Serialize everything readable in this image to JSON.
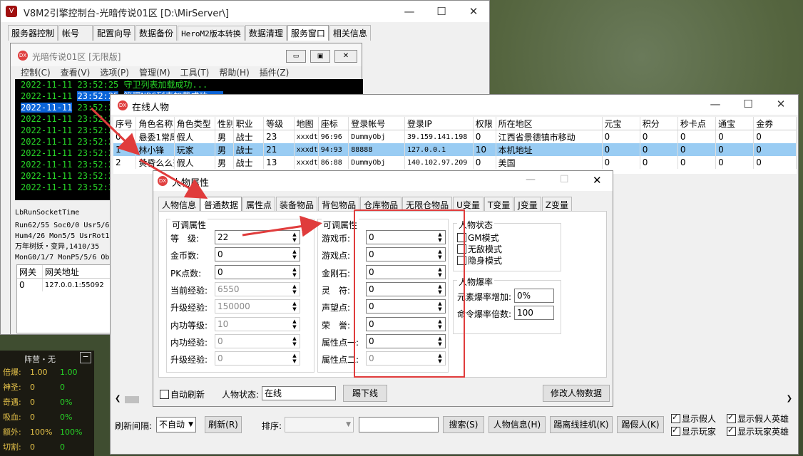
{
  "console_main": {
    "title": "V8M2引擎控制台-光暗传说01区 [D:\\MirServer\\]",
    "tabs": [
      "服务器控制",
      "帐号",
      "配置向导",
      "数据备份",
      "HeroM2版本转换",
      "数据清理",
      "服务窗口",
      "相关信息"
    ]
  },
  "server_window": {
    "title": "光暗传说01区 [无限版]",
    "menu": [
      "控制(C)",
      "查看(V)",
      "选项(P)",
      "管理(M)",
      "工具(T)",
      "帮助(H)",
      "插件(Z)"
    ],
    "log": [
      {
        "date": "2022-11-11",
        "time": "23:52:25",
        "msg": "守卫列表加载成功..."
      },
      {
        "date": "2022-11-11",
        "time": "23:52:25",
        "msg": "管理NPC列表加载成功..."
      },
      {
        "date": "2022-11-11",
        "time": "23:52:2",
        "msg": ""
      },
      {
        "date": "2022-11-11",
        "time": "23:52:2",
        "msg": ""
      },
      {
        "date": "2022-11-11",
        "time": "23:52:2",
        "msg": ""
      },
      {
        "date": "2022-11-11",
        "time": "23:52:2",
        "msg": ""
      },
      {
        "date": "2022-11-11",
        "time": "23:52:2",
        "msg": ""
      },
      {
        "date": "2022-11-11",
        "time": "23:52:2",
        "msg": ""
      },
      {
        "date": "2022-11-11",
        "time": "23:52:2",
        "msg": ""
      },
      {
        "date": "2022-11-11",
        "time": "23:52:3",
        "msg": ""
      }
    ],
    "status": [
      "LbRunSocketTime",
      "Run62/55 Soc0/0 Usr5/6",
      "Hum4/26 Mon5/5 UsrRot1",
      "万年树妖・变异,1410/35",
      "MonG0/1/7 MonP5/5/6 Ob"
    ],
    "gate_headers": [
      "网关",
      "网关地址"
    ],
    "gate_rows": [
      [
        "0",
        "127.0.0.1:55092"
      ]
    ]
  },
  "online": {
    "title": "在线人物",
    "columns": [
      "序号",
      "角色名称",
      "角色类型",
      "性别",
      "职业",
      "等级",
      "地图",
      "座标",
      "登录帐号",
      "登录IP",
      "权限",
      "所在地区",
      "元宝",
      "积分",
      "秒卡点",
      "通宝",
      "金券"
    ],
    "rows": [
      [
        "0",
        "悬委1常尾",
        "假人",
        "男",
        "战士",
        "23",
        "xxxdtt",
        "96:96",
        "DummyObj",
        "39.159.141.198",
        "0",
        "江西省景德镇市移动",
        "0",
        "0",
        "0",
        "0",
        "0"
      ],
      [
        "1",
        "林小锋",
        "玩家",
        "男",
        "战士",
        "21",
        "xxxdtt",
        "94:93",
        "88888",
        "127.0.0.1",
        "10",
        "本机地址",
        "0",
        "0",
        "0",
        "0",
        "0"
      ],
      [
        "2",
        "黄昏么么茶",
        "假人",
        "男",
        "战士",
        "13",
        "xxxdtt",
        "86:88",
        "DummyObj",
        "140.102.97.209",
        "0",
        "美国",
        "0",
        "0",
        "0",
        "0",
        "0"
      ]
    ],
    "bottom": {
      "refresh_label": "刷新间隔:",
      "refresh_value": "不自动",
      "refresh_btn": "刷新(R)",
      "sort_label": "排序:",
      "search_btn": "搜索(S)",
      "info_btn": "人物信息(H)",
      "kick_offline_btn": "踢离线挂机(K)",
      "kick_dummy_btn": "踢假人(K)",
      "chk_dummy": "显示假人",
      "chk_player": "显示玩家",
      "chk_dummy_hero": "显示假人英雄",
      "chk_player_hero": "显示玩家英雄"
    }
  },
  "props": {
    "title": "人物属性",
    "tabs": [
      "人物信息",
      "普通数据",
      "属性点",
      "装备物品",
      "背包物品",
      "仓库物品",
      "无限仓物品",
      "U变量",
      "T变量",
      "J变量",
      "Z变量"
    ],
    "group1_title": "可调属性",
    "group1": [
      {
        "label": "等　级:",
        "value": "22",
        "disabled": false
      },
      {
        "label": "金币数:",
        "value": "0",
        "disabled": false
      },
      {
        "label": "PK点数:",
        "value": "0",
        "disabled": false
      },
      {
        "label": "当前经验:",
        "value": "6550",
        "disabled": true
      },
      {
        "label": "升级经验:",
        "value": "150000",
        "disabled": true
      },
      {
        "label": "内功等级:",
        "value": "10",
        "disabled": true
      },
      {
        "label": "内功经验:",
        "value": "0",
        "disabled": true
      },
      {
        "label": "升级经验:",
        "value": "0",
        "disabled": true
      }
    ],
    "group2_title": "可调属性",
    "group2": [
      {
        "label": "游戏币:",
        "value": "0",
        "disabled": false
      },
      {
        "label": "游戏点:",
        "value": "0",
        "disabled": false
      },
      {
        "label": "金刚石:",
        "value": "0",
        "disabled": false
      },
      {
        "label": "灵　符:",
        "value": "0",
        "disabled": false
      },
      {
        "label": "声望点:",
        "value": "0",
        "disabled": false
      },
      {
        "label": "荣　誉:",
        "value": "0",
        "disabled": false
      },
      {
        "label": "属性点一:",
        "value": "0",
        "disabled": false
      },
      {
        "label": "属性点二:",
        "value": "0",
        "disabled": true
      }
    ],
    "status_title": "人物状态",
    "status_items": [
      "GM模式",
      "无敌模式",
      "隐身模式"
    ],
    "drop_title": "人物爆率",
    "drop_items": [
      {
        "label": "元素爆率增加:",
        "value": "0%"
      },
      {
        "label": "命令爆率倍数:",
        "value": "100"
      }
    ],
    "auto_refresh": "自动刷新",
    "state_label": "人物状态:",
    "state_value": "在线",
    "kick_btn": "踢下线",
    "modify_btn": "修改人物数据"
  },
  "game_panel": {
    "title": "阵营・无",
    "rows": [
      [
        "倍爆:",
        "1.00",
        "1.00"
      ],
      [
        "神圣:",
        "0",
        "0"
      ],
      [
        "奇遇:",
        "0",
        "0%"
      ],
      [
        "吸血:",
        "0",
        "0%"
      ],
      [
        "额外:",
        "100%",
        "100%"
      ],
      [
        "切割:",
        "0",
        "0"
      ]
    ]
  }
}
